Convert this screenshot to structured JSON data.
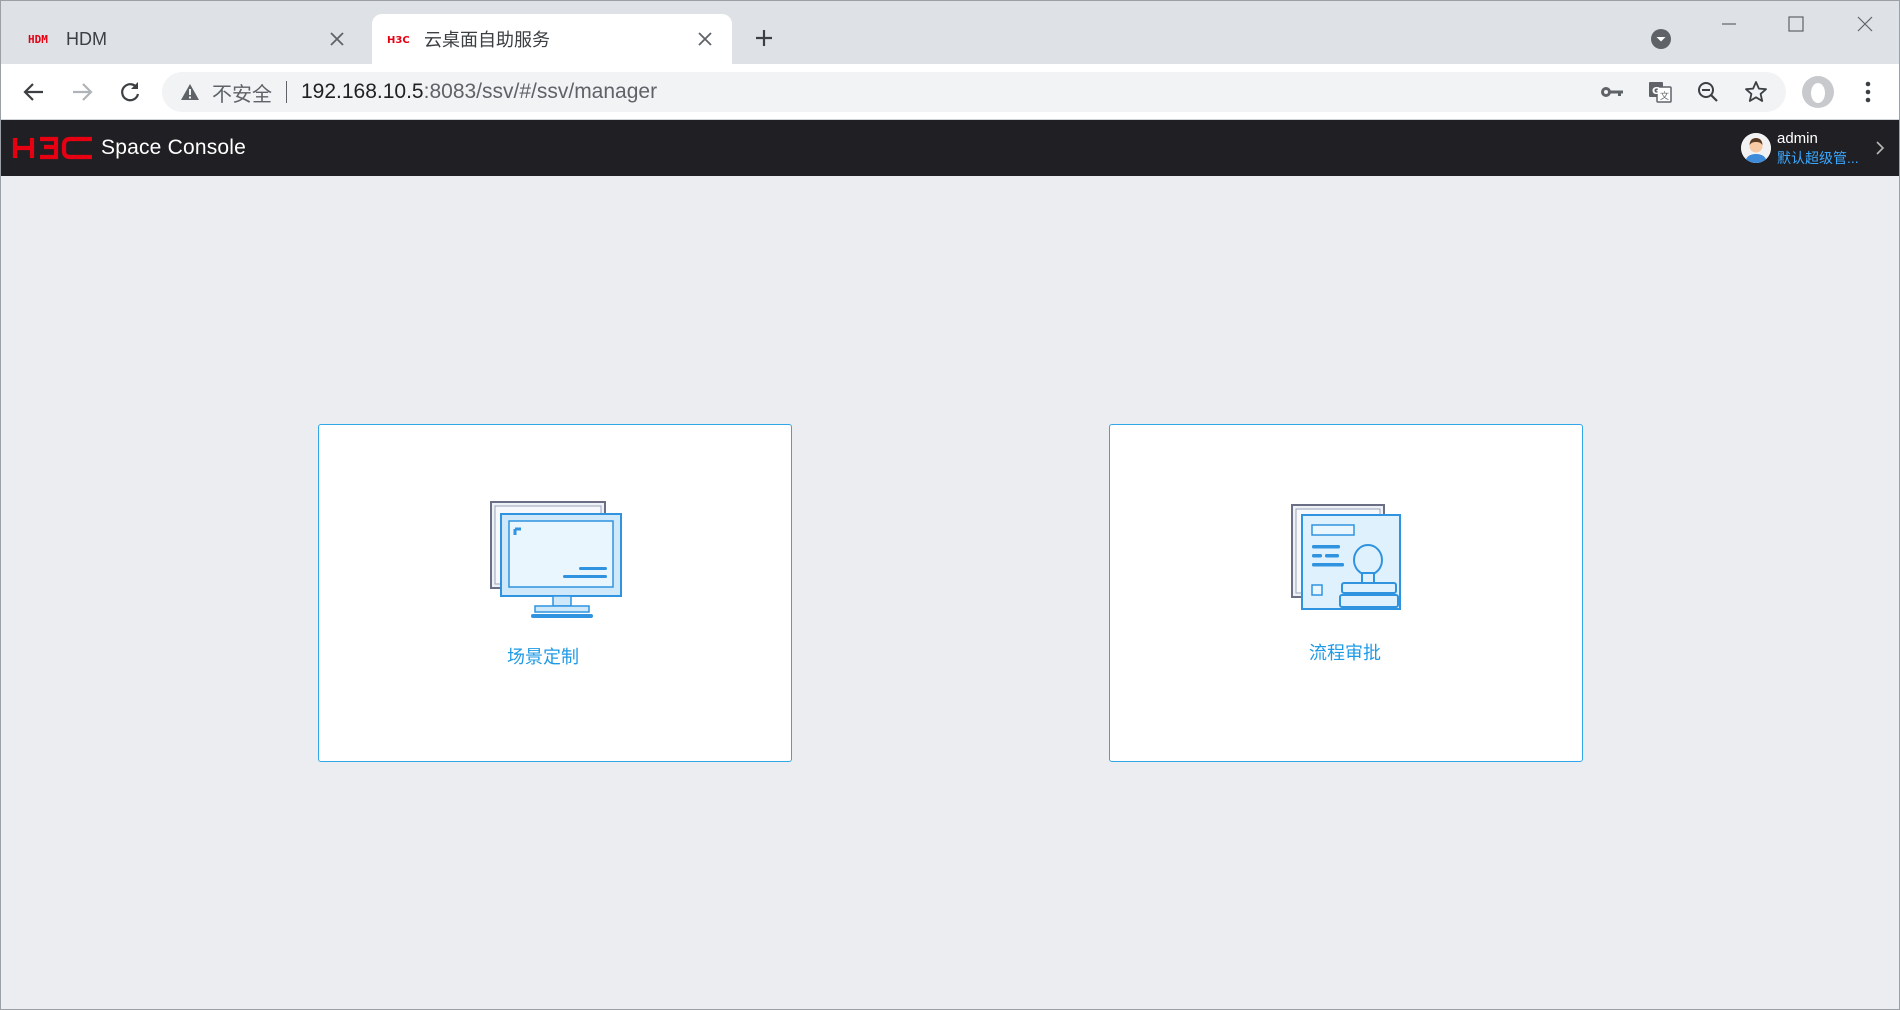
{
  "browser": {
    "tabs": [
      {
        "favicon": "hdm-logo",
        "title": "HDM",
        "active": false
      },
      {
        "favicon": "h3c-logo",
        "title": "云桌面自助服务",
        "active": true
      }
    ],
    "new_tab_icon": "plus-icon",
    "address_bar": {
      "security_label": "不安全",
      "url_host": "192.168.10.5",
      "url_rest": ":8083/ssv/#/ssv/manager"
    },
    "icons": [
      "back-arrow-icon",
      "forward-arrow-icon",
      "reload-icon",
      "warning-icon",
      "key-icon",
      "translate-icon",
      "zoom-out-icon",
      "star-icon",
      "profile-icon",
      "menu-icon"
    ]
  },
  "app": {
    "brand_logo": "H3C",
    "brand_name": "Space Console",
    "user": {
      "name": "admin",
      "role": "默认超级管..."
    }
  },
  "cards": [
    {
      "id": "scene",
      "label": "场景定制",
      "icon": "desktop-monitor-icon"
    },
    {
      "id": "approve",
      "label": "流程审批",
      "icon": "document-stamp-icon"
    }
  ],
  "colors": {
    "header_bg": "#202024",
    "accent": "#1f9ae6",
    "card_border": "#2fa7e8",
    "brand_red": "#e60012"
  }
}
